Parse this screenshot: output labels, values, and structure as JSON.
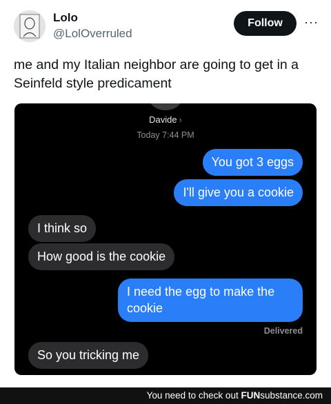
{
  "tweet": {
    "name": "Lolo",
    "handle": "@LolOverruled",
    "follow_label": "Follow",
    "more_label": "···",
    "text": "me and my Italian neighbor are going to get in a Seinfeld style predicament"
  },
  "conversation": {
    "contact": "Davide",
    "timestamp": "Today 7:44 PM",
    "messages": [
      {
        "from": "me",
        "text": "You got 3 eggs"
      },
      {
        "from": "me",
        "text": "I'll give you a cookie"
      },
      {
        "from": "them",
        "text": "I think so"
      },
      {
        "from": "them",
        "text": "How good  is the cookie"
      },
      {
        "from": "me",
        "text": "I need the egg to make the cookie"
      },
      {
        "from": "them",
        "text": "So you tricking me"
      }
    ],
    "delivered": "Delivered"
  },
  "footer": {
    "text": "You need to check out ",
    "brand_bold": "FUN",
    "brand_rest": "substance.com"
  },
  "colors": {
    "sent_bubble": "#2a7ef7",
    "received_bubble": "#2c2c2e",
    "follow_button": "#0f1419"
  }
}
